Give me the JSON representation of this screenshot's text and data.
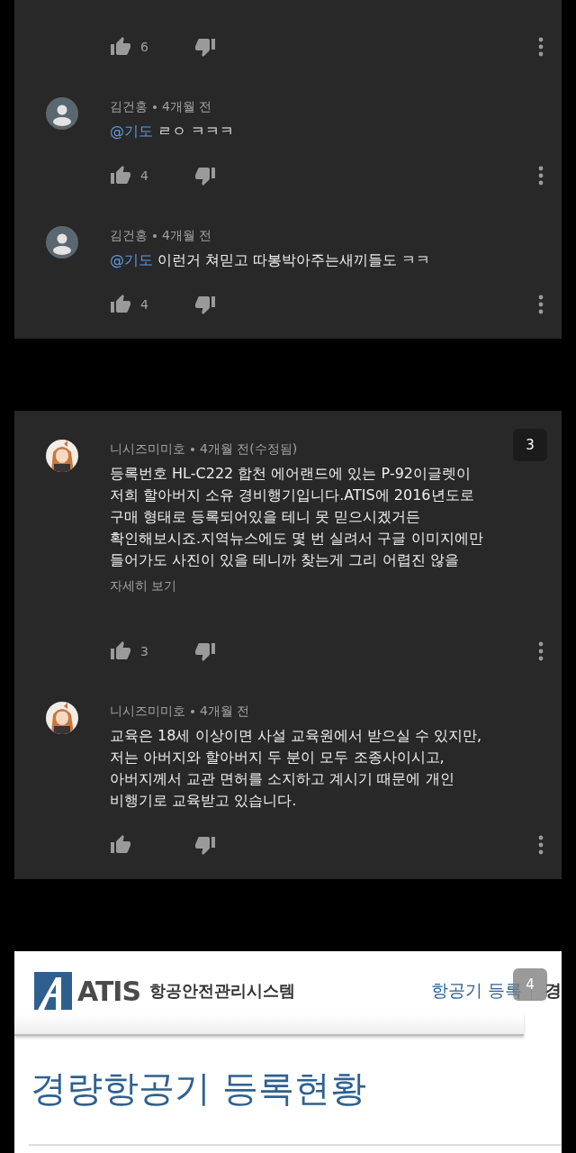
{
  "panels": [
    {
      "kind": "comments",
      "comments": [
        {
          "likes": "6"
        },
        {
          "avatar": {
            "kind": "default"
          },
          "author": "김건홍",
          "time": "4개월 전",
          "mention": "@기도",
          "lines": [
            "ㄹㅇ ㅋㅋㅋ"
          ],
          "likes": "4"
        },
        {
          "avatar": {
            "kind": "default"
          },
          "author": "김건홍",
          "time": "4개월 전",
          "mention": "@기도",
          "lines": [
            "이런거 쳐믿고 따봉박아주는새끼들도 ㅋㅋ"
          ],
          "likes": "4"
        }
      ]
    },
    {
      "kind": "comments",
      "badge": "3",
      "comments": [
        {
          "avatar": {
            "kind": "picture"
          },
          "author": "니시즈미미호",
          "time": "4개월 전(수정됨)",
          "lines": [
            "등록번호 HL-C222 합천 에어랜드에 있는 P-92이글렛이",
            "저희 할아버지 소유 경비행기입니다.ATIS에 2016년도로",
            "구매 형태로 등록되어있을 테니 못 믿으시겠거든",
            "확인해보시죠.지역뉴스에도 몇 번 실려서 구글 이미지에만",
            "들어가도 사진이 있을 테니까 찾는게 그리 어렵진 않을"
          ],
          "more": "자세히 보기",
          "likes": "3"
        },
        {
          "avatar": {
            "kind": "picture"
          },
          "author": "니시즈미미호",
          "time": "4개월 전",
          "lines": [
            "교육은 18세 이상이면 사설 교육원에서 받으실 수 있지만,",
            "저는 아버지와 할아버지 두 분이 모두 조종사이시고,",
            "아버지께서 교관 면허를 소지하고 계시기 때문에 개인",
            "비행기로 교육받고 있습니다."
          ]
        }
      ]
    },
    {
      "kind": "website",
      "badge": "4",
      "logo": "ATIS",
      "system_name": "항공안전관리시스템",
      "nav": [
        "항공기 등록",
        "경"
      ],
      "heading": "경량항공기 등록현황"
    }
  ]
}
